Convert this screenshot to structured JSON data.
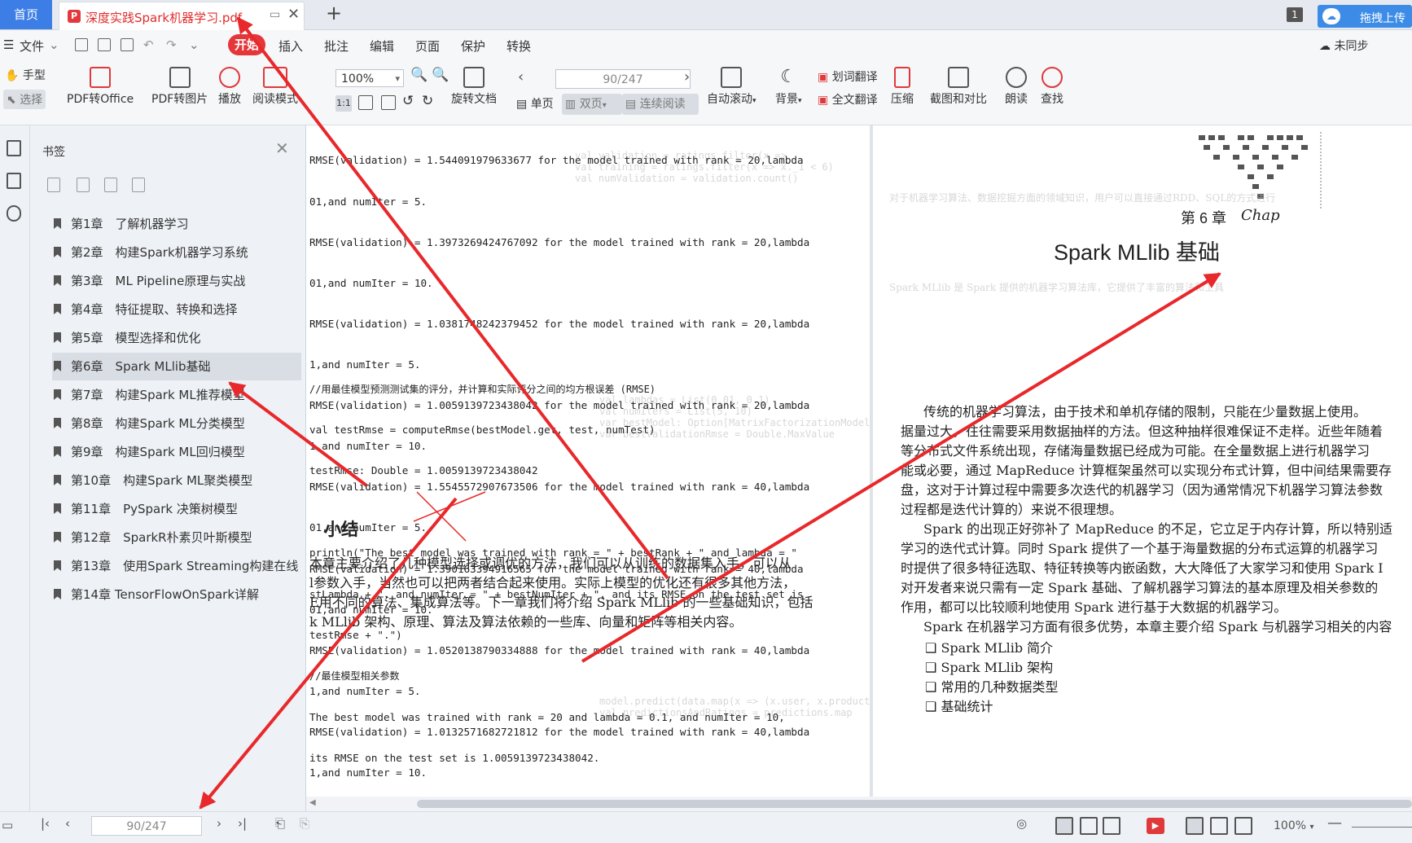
{
  "tabs": {
    "home": "首页",
    "document": "深度实践Spark机器学习.pdf",
    "tab_count": "1",
    "upload": "拖拽上传"
  },
  "menu": {
    "file": "文件",
    "start": "开始",
    "insert": "插入",
    "annotate": "批注",
    "edit": "编辑",
    "page": "页面",
    "protect": "保护",
    "convert": "转换",
    "sync": "未同步"
  },
  "toolbar": {
    "hand": "手型",
    "select": "选择",
    "pdf_to_office": "PDF转Office",
    "pdf_to_image": "PDF转图片",
    "play": "播放",
    "read_mode": "阅读模式",
    "zoom": "100%",
    "rotate": "旋转文档",
    "page_indicator": "90/247",
    "single": "单页",
    "double": "双页",
    "continuous": "连续阅读",
    "auto_scroll": "自动滚动",
    "background": "背景",
    "word_translate": "划词翻译",
    "full_translate": "全文翻译",
    "compress": "压缩",
    "screenshot_compare": "截图和对比",
    "read_aloud": "朗读",
    "find": "查找"
  },
  "bookmarks": {
    "title": "书签",
    "items": [
      "第1章　了解机器学习",
      "第2章　构建Spark机器学习系统",
      "第3章　ML Pipeline原理与实战",
      "第4章　特征提取、转换和选择",
      "第5章　模型选择和优化",
      "第6章　Spark MLlib基础",
      "第7章　构建Spark ML推荐模型",
      "第8章　构建Spark ML分类模型",
      "第9章　构建Spark ML回归模型",
      "第10章　构建Spark ML聚类模型",
      "第11章　PySpark 决策树模型",
      "第12章　SparkR朴素贝叶斯模型",
      "第13章　使用Spark Streaming构建在线",
      "第14章 TensorFlowOnSpark详解"
    ]
  },
  "left_page": {
    "code_lines": [
      "RMSE(validation) = 1.544091979633677 for the model trained with rank = 20,lambda",
      "01,and numIter = 5.",
      "RMSE(validation) = 1.3973269424767092 for the model trained with rank = 20,lambda",
      "01,and numIter = 10.",
      "RMSE(validation) = 1.0381748242379452 for the model trained with rank = 20,lambda",
      "1,and numIter = 5.",
      "RMSE(validation) = 1.0059139723438042 for the model trained with rank = 20,lambda",
      "1,and numIter = 10.",
      "RMSE(validation) = 1.5545572907673506 for the model trained with rank = 40,lambda",
      "01,and numIter = 5.",
      "RMSE(validation) = 1.390163394916565 for the model trained with rank = 40,lambda",
      "01,and numIter = 10.",
      "RMSE(validation) = 1.0520138790334888 for the model trained with rank = 40,lambda",
      "1,and numIter = 5.",
      "RMSE(validation) = 1.0132571682721812 for the model trained with rank = 40,lambda",
      "1,and numIter = 10."
    ],
    "code2": [
      "//用最佳模型预测测试集的评分，并计算和实际评分之间的均方根误差 (RMSE)",
      "val testRmse = computeRmse(bestModel.get, test, numTest)",
      "testRmse: Double = 1.0059139723438042",
      "",
      "println(\"The best model was trained with rank = \" + bestRank + \" and lambda = \"",
      "stLambda + \", and numIter = \" + bestNumIter + \", and its RMSE on the test set is",
      "testRmse + \".\")",
      "//最佳模型相关参数",
      "The best model was trained with rank = 20 and lambda = 0.1, and numIter = 10,",
      "its RMSE on the test set is 1.0059139723438042."
    ],
    "summary_heading": "小结",
    "summary_lines": [
      "本章主要介绍了几种模型选择或调优的方法，我们可以从训练的数据集入手，可以从",
      "l参数入手，当然也可以把两者结合起来使用。实际上模型的优化还有很多其他方法，",
      "E用不同的算法、集成算法等。下一章我们将介绍 Spark MLlib 的一些基础知识，包括",
      "k MLlib 架构、原理、算法及算法依赖的一些库、向量和矩阵等相关内容。"
    ]
  },
  "right_page": {
    "chapter_label": "第 6 章",
    "chapter_tag": "Chap",
    "chapter_title": "Spark MLlib 基础",
    "body_lines": [
      "传统的机器学习算法，由于技术和单机存储的限制，只能在少量数据上使用。",
      "据量过大，往往需要采用数据抽样的方法。但这种抽样很难保证不走样。近些年随着",
      "等分布式文件系统出现，存储海量数据已经成为可能。在全量数据上进行机器学习",
      "能或必要，通过 MapReduce 计算框架虽然可以实现分布式计算，但中间结果需要存",
      "盘，这对于计算过程中需要多次迭代的机器学习（因为通常情况下机器学习算法参数",
      "过程都是迭代计算的）来说不很理想。",
      "Spark 的出现正好弥补了 MapReduce 的不足，它立足于内存计算，所以特别适",
      "学习的迭代式计算。同时 Spark 提供了一个基于海量数据的分布式运算的机器学习",
      "时提供了很多特征选取、特征转换等内嵌函数，大大降低了大家学习和使用 Spark I",
      "对开发者来说只需有一定 Spark 基础、了解机器学习算法的基本原理及相关参数的",
      "作用，都可以比较顺利地使用 Spark 进行基于大数据的机器学习。",
      "Spark 在机器学习方面有很多优势，本章主要介绍 Spark 与机器学习相关的内容"
    ],
    "bullets": [
      "Spark MLlib 简介",
      "Spark MLlib 架构",
      "常用的几种数据类型",
      "基础统计"
    ]
  },
  "status": {
    "page_indicator": "90/247",
    "zoom": "100%"
  },
  "colors": {
    "accent_blue": "#3d7de6",
    "accent_red": "#e5373a",
    "annotation_red": "#e8282b"
  }
}
